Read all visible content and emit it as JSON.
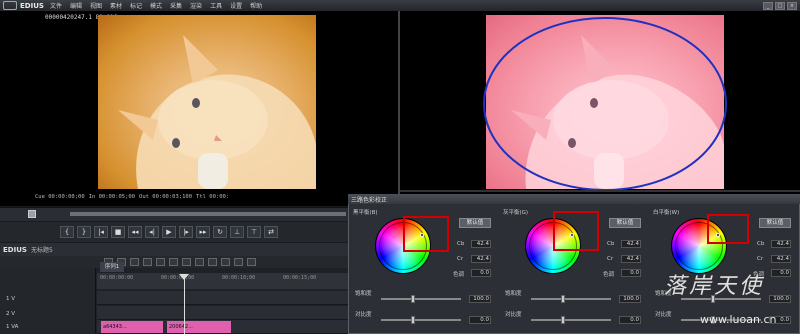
{
  "app": {
    "title": "EDIUS"
  },
  "menu": [
    "文件",
    "编辑",
    "视图",
    "素材",
    "标记",
    "模式",
    "采集",
    "渲染",
    "工具",
    "设置",
    "帮助"
  ],
  "window_controls": [
    "_",
    "□",
    "×"
  ],
  "player": {
    "timecode_top": "00000420247.1 80.016",
    "timecodes": [
      "Cue 00:00:00;00",
      "In 00:00:05;00",
      "Out 00:00:03;100",
      "Ttl 00:00:"
    ]
  },
  "timeline": {
    "logo": "EDIUS",
    "sequence_name": "无标题5",
    "sequence_tab": "序列1",
    "ruler_labels": [
      "00:00:00:00",
      "00:00:05;00",
      "00:00:10;00",
      "00:00:15;00"
    ],
    "tracks": [
      {
        "label": "1 V",
        "clip": ""
      },
      {
        "label": "2 V",
        "clip": ""
      },
      {
        "label": "1 VA",
        "clips": [
          "a64343...",
          "200642..."
        ]
      }
    ],
    "transport_icons": [
      "mark-in",
      "mark-out",
      "prev",
      "stop",
      "rewind",
      "step-back",
      "play",
      "step-fwd",
      "ffwd",
      "loop",
      "insert",
      "overwrite",
      "replace"
    ]
  },
  "color_correction": {
    "title": "三路色彩校正",
    "panels": [
      {
        "label": "黑平衡(B)",
        "default_button": "默认值",
        "cb_label": "Cb",
        "cb_value": "42.4",
        "cr_label": "Cr",
        "cr_value": "42.4",
        "hue_label": "色调",
        "hue_value": "0.0",
        "saturation_label": "饱和度",
        "saturation_value": "100.0",
        "contrast_label": "对比度",
        "contrast_value": "0.0"
      },
      {
        "label": "灰平衡(G)",
        "default_button": "默认值",
        "cb_label": "Cb",
        "cb_value": "42.4",
        "cr_label": "Cr",
        "cr_value": "42.4",
        "hue_label": "色调",
        "hue_value": "0.0",
        "saturation_label": "饱和度",
        "saturation_value": "100.0",
        "contrast_label": "对比度",
        "contrast_value": "0.0"
      },
      {
        "label": "白平衡(W)",
        "default_button": "默认值",
        "cb_label": "Cb",
        "cb_value": "42.4",
        "cr_label": "Cr",
        "cr_value": "42.4",
        "hue_label": "色调",
        "hue_value": "0.0",
        "saturation_label": "饱和度",
        "saturation_value": "100.0",
        "contrast_label": "对比度",
        "contrast_value": "0.0"
      }
    ]
  },
  "watermark": {
    "text": "落岸天使",
    "url": "www.luoan.cn"
  },
  "colors": {
    "highlight": "#d40000",
    "ellipse": "#2030c0",
    "player_tint": "#e7b06a",
    "recorder_tint": "#f8a1b0"
  }
}
